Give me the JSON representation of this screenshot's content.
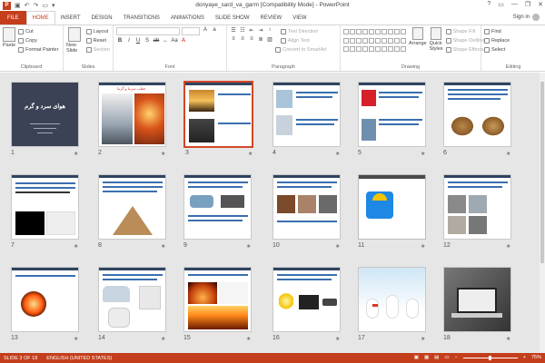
{
  "window": {
    "title": "donyaye_sard_va_garm [Compatibility Mode] - PowerPoint",
    "logo": "P"
  },
  "tabs": [
    "FILE",
    "HOME",
    "INSERT",
    "DESIGN",
    "TRANSITIONS",
    "ANIMATIONS",
    "SLIDE SHOW",
    "REVIEW",
    "VIEW"
  ],
  "active_tab": "HOME",
  "signin": "Sign in",
  "ribbon": {
    "clipboard": {
      "label": "Clipboard",
      "paste": "Paste",
      "cut": "Cut",
      "copy": "Copy",
      "format_painter": "Format Painter"
    },
    "slides": {
      "label": "Slides",
      "new_slide": "New Slide",
      "layout": "Layout",
      "reset": "Reset",
      "section": "Section"
    },
    "font": {
      "label": "Font"
    },
    "paragraph": {
      "label": "Paragraph",
      "text_direction": "Text Direction",
      "align_text": "Align Text",
      "convert_smartart": "Convert to SmartArt"
    },
    "drawing": {
      "label": "Drawing",
      "arrange": "Arrange",
      "quick_styles": "Quick Styles",
      "shape_fill": "Shape Fill",
      "shape_outline": "Shape Outline",
      "shape_effects": "Shape Effects"
    },
    "editing": {
      "label": "Editing",
      "find": "Find",
      "replace": "Replace",
      "select": "Select"
    }
  },
  "slides": [
    {
      "n": "1",
      "title": "هوای سرد و گرم"
    },
    {
      "n": "2",
      "title": "قطب سرما و گرما"
    },
    {
      "n": "3",
      "title": ""
    },
    {
      "n": "4",
      "title": ""
    },
    {
      "n": "5",
      "title": ""
    },
    {
      "n": "6",
      "title": ""
    },
    {
      "n": "7",
      "title": ""
    },
    {
      "n": "8",
      "title": ""
    },
    {
      "n": "9",
      "title": ""
    },
    {
      "n": "10",
      "title": ""
    },
    {
      "n": "11",
      "title": ""
    },
    {
      "n": "12",
      "title": ""
    },
    {
      "n": "13",
      "title": ""
    },
    {
      "n": "14",
      "title": ""
    },
    {
      "n": "15",
      "title": ""
    },
    {
      "n": "16",
      "title": ""
    },
    {
      "n": "17",
      "title": ""
    },
    {
      "n": "18",
      "title": ""
    }
  ],
  "selected_slide": "3",
  "star": "★",
  "status": {
    "slide_info": "SLIDE 3 OF 18",
    "language": "ENGLISH (UNITED STATES)",
    "zoom": "75%",
    "zoom_fraction": 0.5
  },
  "colors": {
    "accent": "#c43e1c",
    "selected": "#d24726",
    "header": "#2e4460"
  }
}
